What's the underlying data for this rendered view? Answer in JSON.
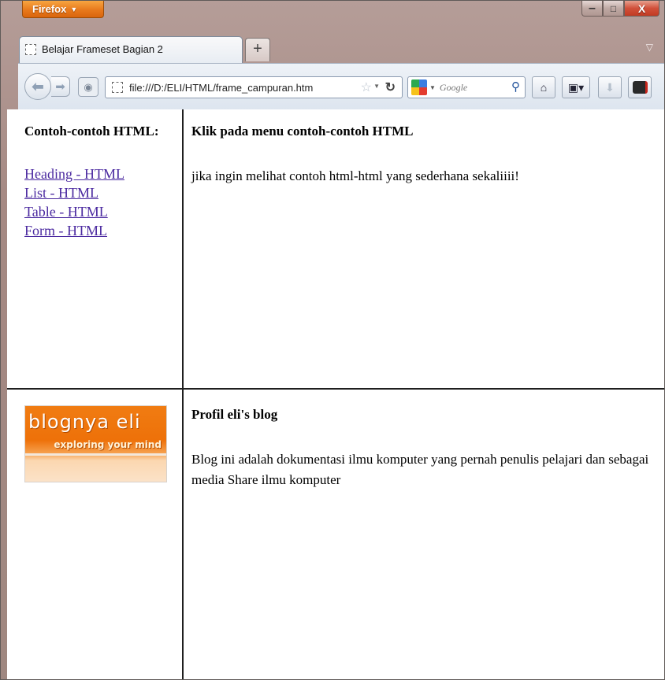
{
  "window": {
    "firefox_button": "Firefox",
    "controls": {
      "minimize": "–",
      "maximize": "□",
      "close": "X"
    }
  },
  "tabs": [
    {
      "title": "Belajar Frameset Bagian 2"
    }
  ],
  "new_tab_label": "+",
  "toolbar": {
    "url": "file:///D:/ELI/HTML/frame_campuran.htm",
    "search_placeholder": "Google"
  },
  "frames": {
    "menu": {
      "heading": "Contoh-contoh HTML:",
      "links": [
        "Heading - HTML",
        "List - HTML",
        "Table - HTML",
        "Form - HTML"
      ]
    },
    "main": {
      "heading": "Klik pada menu contoh-contoh HTML",
      "text": "jika ingin melihat contoh html-html yang sederhana sekaliiii!"
    },
    "logo": {
      "title": "blognya eli",
      "tagline": "exploring your mind"
    },
    "profile": {
      "heading": "Profil eli's blog",
      "text": "Blog ini adalah dokumentasi ilmu komputer yang pernah penulis pelajari dan sebagai media Share ilmu komputer"
    }
  },
  "colors": {
    "link": "#4b2aa0",
    "firefox_orange": "#e8791c",
    "close_red": "#c13b23",
    "frame_border": "#1f1f1f"
  }
}
